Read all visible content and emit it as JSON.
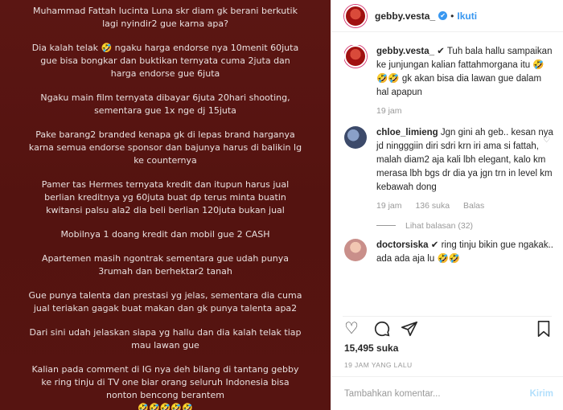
{
  "image_text": {
    "paragraphs": [
      "Muhammad Fattah lucinta Luna skr diam gk berani berkutik\nlagi nyindir2 gue karna apa?",
      "Dia kalah telak 🤣 ngaku harga endorse nya 10menit 60juta\ngue bisa bongkar dan buktikan ternyata cuma 2juta dan\nharga endorse gue 6juta",
      "Ngaku main film ternyata dibayar 6juta 20hari shooting,\nsementara gue 1x nge dj 15juta",
      "Pake barang2 branded kenapa gk di lepas brand harganya\nkarna semua endorse sponsor dan bajunya harus di balikin lg\nke counternya",
      "Pamer tas Hermes ternyata kredit dan itupun harus jual\nberlian kreditnya yg 60juta buat dp terus minta buatin\nkwitansi palsu ala2 dia beli berlian 120juta bukan jual",
      "Mobilnya 1 doang kredit dan mobil gue 2 CASH",
      "Apartemen masih ngontrak sementara gue udah punya\n3rumah dan berhektar2 tanah",
      "Gue punya talenta dan prestasi yg jelas, sementara dia cuma\njual teriakan gagak buat makan dan gk punya talenta apa2",
      "Dari sini udah jelaskan siapa yg hallu dan dia kalah telak tiap\nmau lawan gue",
      "Kalian pada comment di IG nya deh bilang di tantang gebby\nke ring tinju di TV one biar orang seluruh Indonesia bisa\nnonton bencong berantem\n🤣🤣🤣🤣🤣"
    ]
  },
  "header": {
    "username": "gebby.vesta_",
    "verified_mark": "✔",
    "separator": "•",
    "follow_label": "Ikuti"
  },
  "comments": [
    {
      "username": "gebby.vesta_",
      "text": " ✔ Tuh bala hallu sampaikan ke junjungan kalian fattahmorgana itu 🤣🤣🤣 gk akan bisa dia lawan gue dalam hal apapun",
      "time": "19 jam"
    },
    {
      "username": "chloe_limieng",
      "text": " Jgn gini ah geb.. kesan nya jd ningggiin diri sdri krn iri ama si fattah, malah diam2 aja kali lbh elegant, kalo km merasa lbh bgs dr dia ya jgn trn in level km kebawah dong",
      "time": "19 jam",
      "likes": "136 suka",
      "reply": "Balas",
      "view_replies": "Lihat balasan (32)"
    },
    {
      "username": "doctorsiska",
      "text": " ✔ ring tinju bikin gue ngakak.. ada ada aja lu 🤣🤣"
    }
  ],
  "actions": {
    "like_icon": "heart-icon",
    "comment_icon": "comment-icon",
    "share_icon": "share-icon",
    "save_icon": "bookmark-icon"
  },
  "likes_text": "15,495 suka",
  "timestamp": "19 JAM YANG LALU",
  "comment_box": {
    "placeholder": "Tambahkan komentar...",
    "post_label": "Kirim"
  },
  "colors": {
    "image_background": "#5a1512",
    "link_blue": "#3897f0",
    "post_button_disabled": "#b2dffc"
  }
}
